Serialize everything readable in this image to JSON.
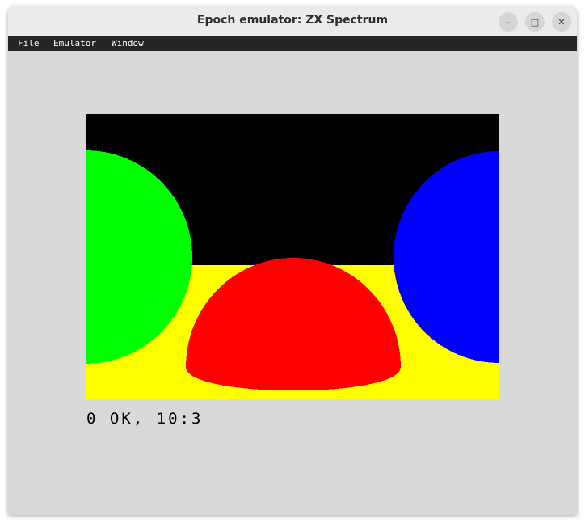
{
  "window": {
    "title": "Epoch emulator: ZX Spectrum",
    "controls": {
      "minimize": "–",
      "maximize": "□",
      "close": "✕"
    }
  },
  "menubar": {
    "items": [
      "File",
      "Emulator",
      "Window"
    ]
  },
  "screen": {
    "colors": {
      "sky": "#000000",
      "floor": "#ffff00",
      "left_sphere": "#00ff00",
      "center_sphere": "#ff0000",
      "right_sphere": "#0000ff"
    },
    "status_text": "0 OK, 10:3"
  }
}
